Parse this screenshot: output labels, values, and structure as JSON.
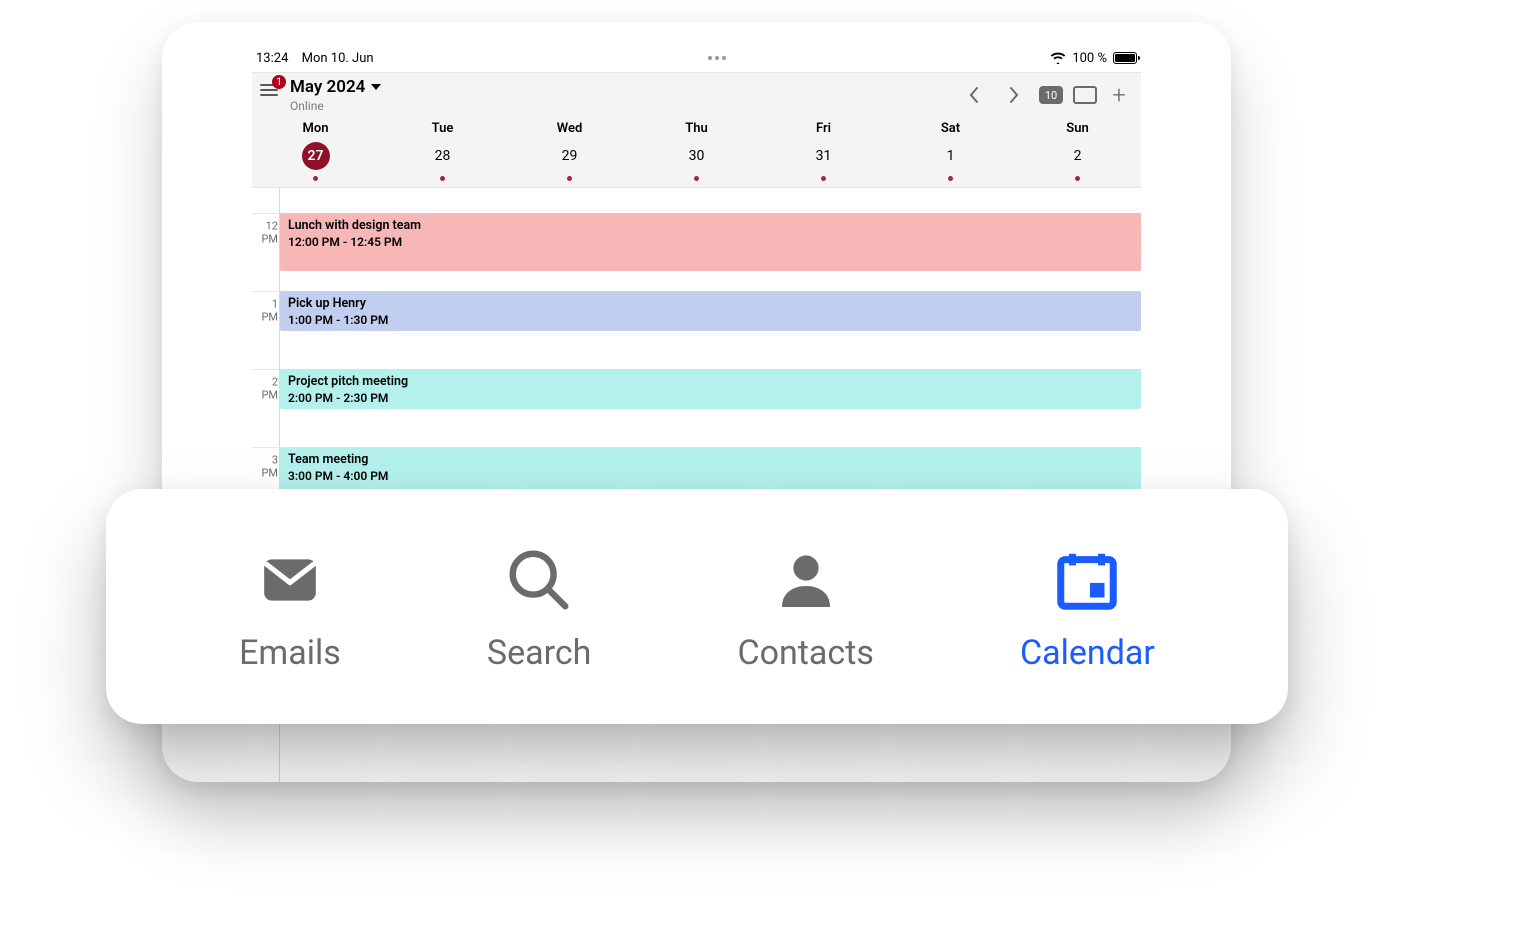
{
  "statusbar": {
    "time": "13:24",
    "date": "Mon 10. Jun",
    "battery_text": "100 %"
  },
  "header": {
    "menu_badge": "1",
    "month_title": "May 2024",
    "status_text": "Online",
    "daycount_badge": "10"
  },
  "weekdays": [
    {
      "dow": "Mon",
      "day": "27",
      "active": true
    },
    {
      "dow": "Tue",
      "day": "28",
      "active": false
    },
    {
      "dow": "Wed",
      "day": "29",
      "active": false
    },
    {
      "dow": "Thu",
      "day": "30",
      "active": false
    },
    {
      "dow": "Fri",
      "day": "31",
      "active": false
    },
    {
      "dow": "Sat",
      "day": "1",
      "active": false
    },
    {
      "dow": "Sun",
      "day": "2",
      "active": false
    }
  ],
  "hours": [
    {
      "label": "12\nPM",
      "topPx": 25
    },
    {
      "label": "1\nPM",
      "topPx": 103
    },
    {
      "label": "2\nPM",
      "topPx": 181
    },
    {
      "label": "3\nPM",
      "topPx": 259
    }
  ],
  "events": [
    {
      "title": "Lunch with design team",
      "time": "12:00 PM - 12:45 PM",
      "topPx": 25,
      "heightPx": 58,
      "color": "#f8b7b7"
    },
    {
      "title": "Pick up Henry",
      "time": "1:00 PM - 1:30 PM",
      "topPx": 103,
      "heightPx": 40,
      "color": "#c2cef0"
    },
    {
      "title": "Project pitch meeting",
      "time": "2:00 PM - 2:30 PM",
      "topPx": 181,
      "heightPx": 40,
      "color": "#b4f0ec"
    },
    {
      "title": "Team meeting",
      "time": "3:00 PM - 4:00 PM",
      "topPx": 259,
      "heightPx": 78,
      "color": "#b4f0ec"
    }
  ],
  "tabs": [
    {
      "id": "emails",
      "label": "Emails",
      "active": false
    },
    {
      "id": "search",
      "label": "Search",
      "active": false
    },
    {
      "id": "contacts",
      "label": "Contacts",
      "active": false
    },
    {
      "id": "calendar",
      "label": "Calendar",
      "active": true
    }
  ]
}
